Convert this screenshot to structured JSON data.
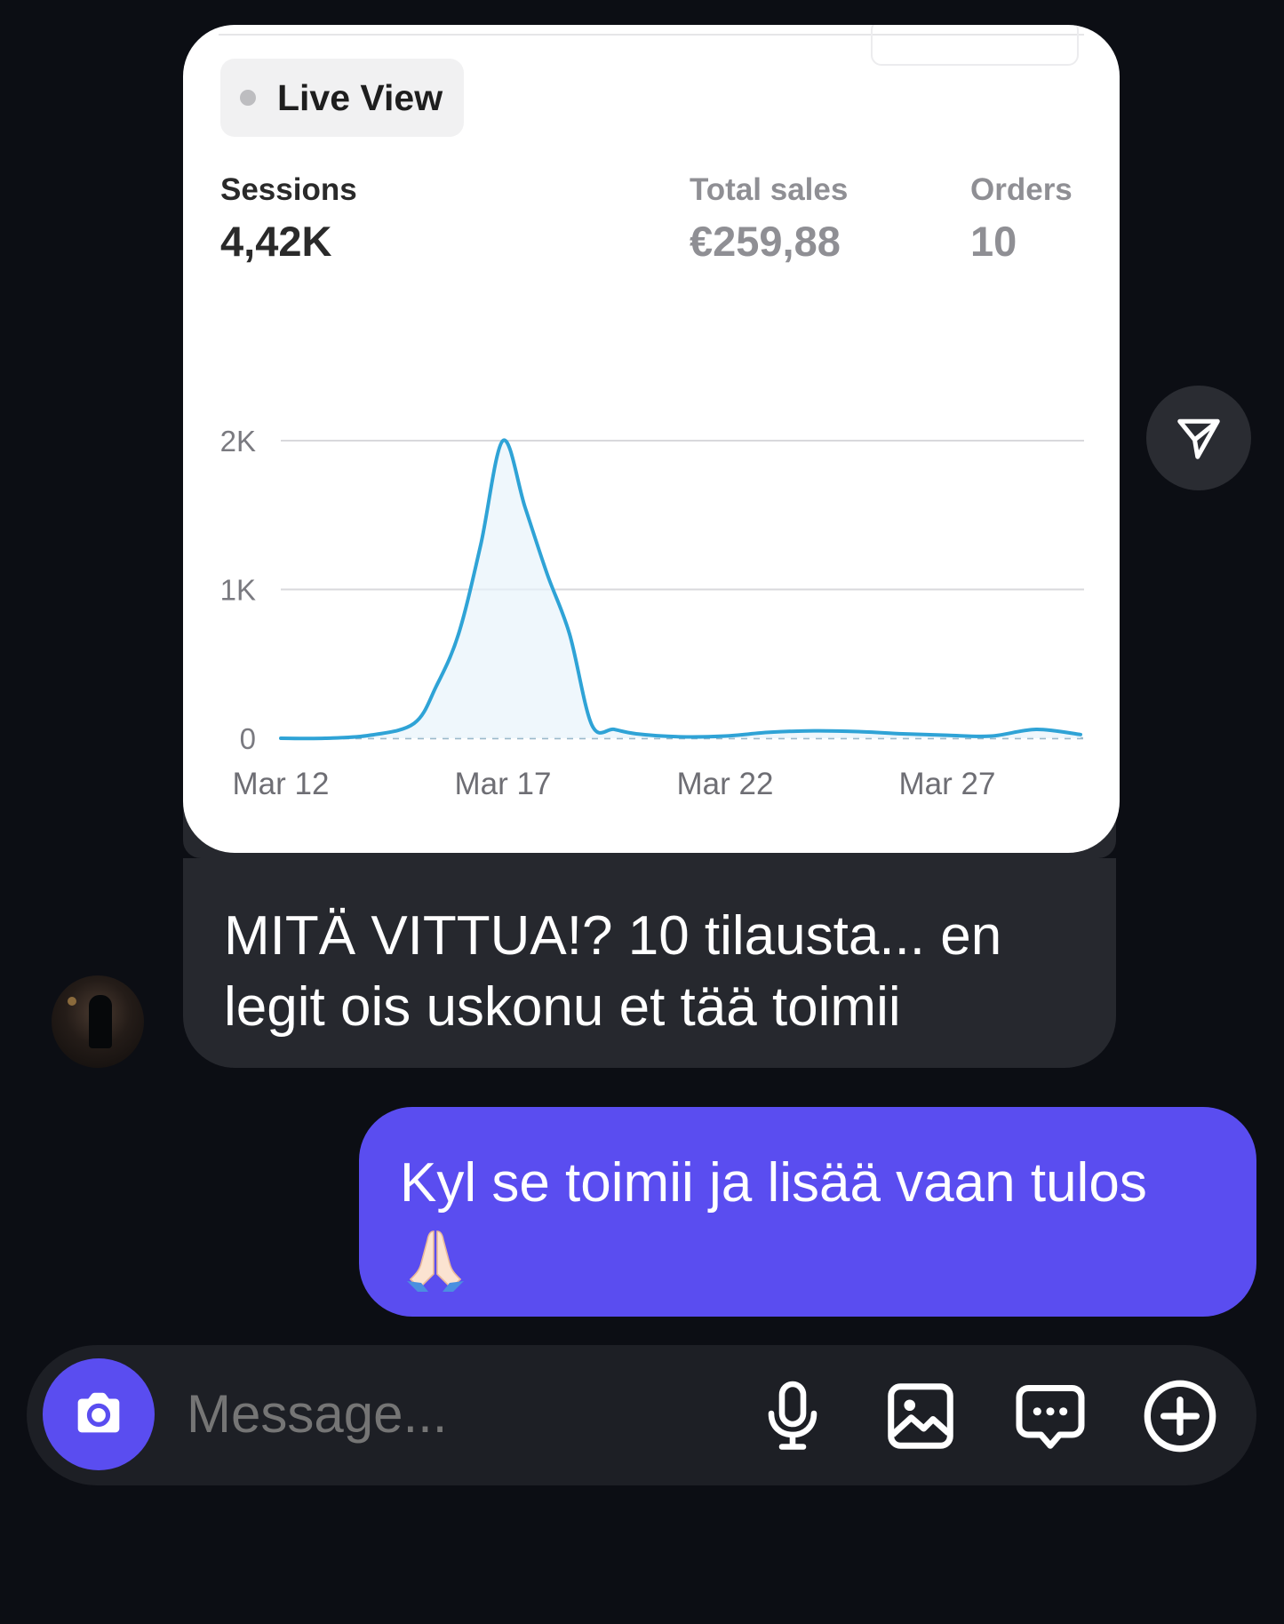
{
  "dashboard": {
    "live_view_label": "Live View",
    "metrics": [
      {
        "label": "Sessions",
        "value": "4,42K"
      },
      {
        "label": "Total sales",
        "value": "€259,88"
      },
      {
        "label": "Orders",
        "value": "10"
      }
    ]
  },
  "chart_data": {
    "type": "line",
    "x_ticks": [
      "Mar 12",
      "Mar 17",
      "Mar 22",
      "Mar 27"
    ],
    "y_ticks": [
      "0",
      "1K",
      "2K"
    ],
    "ylim": [
      0,
      2000
    ],
    "grid": true,
    "baseline": "dashed",
    "line_color": "#2fa3d6",
    "series": [
      {
        "x": [
          12,
          13,
          14,
          15,
          15.5,
          16,
          16.5,
          17,
          17.5,
          18,
          18.5,
          19,
          19.5,
          20,
          21,
          22,
          23,
          24,
          25,
          26,
          27,
          28,
          29,
          30
        ],
        "y": [
          0,
          0,
          20,
          100,
          350,
          700,
          1300,
          2000,
          1550,
          1100,
          700,
          90,
          60,
          30,
          10,
          15,
          40,
          50,
          45,
          30,
          20,
          15,
          60,
          25
        ]
      }
    ]
  },
  "messages": {
    "incoming_text": "MITÄ VITTUA!? 10 tilausta... en legit ois uskonu et tää toimii",
    "outgoing_text": "Kyl se toimii ja lisää vaan tulos",
    "outgoing_emoji": "folded-hands-emoji"
  },
  "composer": {
    "placeholder": "Message..."
  },
  "colors": {
    "background": "#0c0e14",
    "incoming_bubble": "#26282e",
    "outgoing_bubble": "#5a4df0",
    "accent": "#5a4df0"
  }
}
